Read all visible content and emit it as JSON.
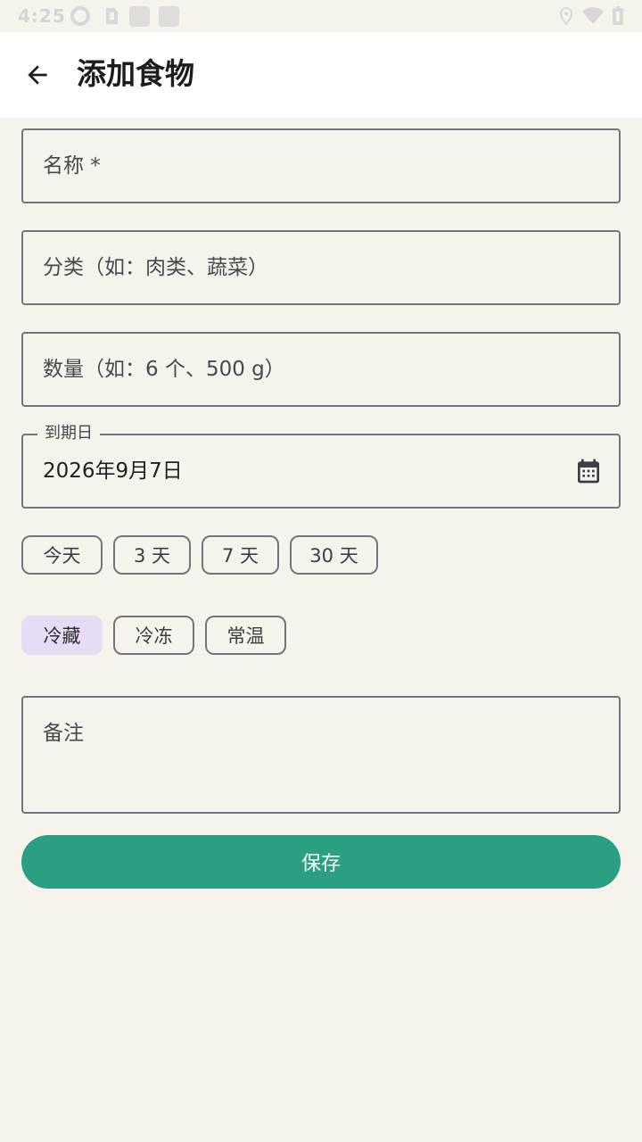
{
  "status_bar": {
    "time": "4:25"
  },
  "app_bar": {
    "title": "添加食物"
  },
  "form": {
    "name_placeholder": "名称 *",
    "category_placeholder": "分类（如：肉类、蔬菜）",
    "quantity_placeholder": "数量（如：6 个、500 g）",
    "expiry": {
      "label": "到期日",
      "value": "2026年9月7日"
    },
    "quick_dates": [
      "今天",
      "3 天",
      "7 天",
      "30 天"
    ],
    "storage_options": [
      {
        "label": "冷藏",
        "selected": true
      },
      {
        "label": "冷冻",
        "selected": false
      },
      {
        "label": "常温",
        "selected": false
      }
    ],
    "notes_placeholder": "备注",
    "save_label": "保存"
  },
  "colors": {
    "accent": "#2b9f82",
    "selected_chip": "#e6dcf5",
    "background": "#f6f3ec",
    "outline": "#77737a"
  }
}
